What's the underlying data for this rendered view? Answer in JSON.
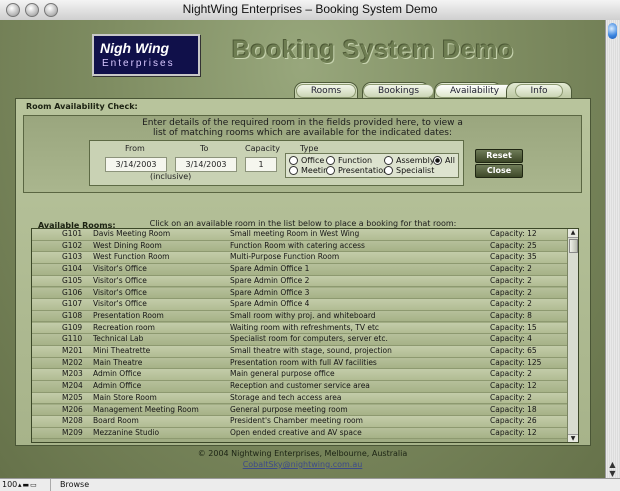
{
  "window": {
    "title": "NightWing Enterprises – Booking System Demo"
  },
  "logo": {
    "line1_a": "Nigh",
    "line1_b": "Wing",
    "line2": "Enterprises"
  },
  "header": {
    "title": "Booking System Demo"
  },
  "tabs": [
    {
      "label": "Rooms"
    },
    {
      "label": "Bookings"
    },
    {
      "label": "Availability"
    },
    {
      "label": "Info"
    }
  ],
  "check": {
    "label": "Room Availability Check:",
    "instruction1": "Enter details of the required room in the fields provided here, to view a",
    "instruction2": "list of matching rooms which are available for the indicated dates:",
    "from_label": "From",
    "to_label": "To",
    "capacity_label": "Capacity",
    "type_label": "Type",
    "from_value": "3/14/2003",
    "to_value": "3/14/2003",
    "capacity_value": "1",
    "inclusive": "(inclusive)",
    "types": [
      "Office",
      "Function",
      "Assembly",
      "All",
      "Meeting",
      "Presentation",
      "Specialist"
    ],
    "selected_type": "All",
    "reset": "Reset",
    "close": "Close"
  },
  "available": {
    "label": "Available Rooms:",
    "instruction": "Click on an available room in the list below to place a booking for that room:",
    "rows": [
      [
        "G101",
        "Davis Meeting Room",
        "Small meeting Room in West Wing",
        "Capacity: 12"
      ],
      [
        "G102",
        "West Dining Room",
        "Function Room with catering access",
        "Capacity: 25"
      ],
      [
        "G103",
        "West Function Room",
        "Multi-Purpose Function Room",
        "Capacity: 35"
      ],
      [
        "G104",
        "Visitor's Office",
        "Spare Admin Office 1",
        "Capacity: 2"
      ],
      [
        "G105",
        "Visitor's Office",
        "Spare Admin Office 2",
        "Capacity: 2"
      ],
      [
        "G106",
        "Visitor's Office",
        "Spare Admin Office 3",
        "Capacity: 2"
      ],
      [
        "G107",
        "Visitor's Office",
        "Spare Admin Office 4",
        "Capacity: 2"
      ],
      [
        "G108",
        "Presentation Room",
        "Small room withy proj. and whiteboard",
        "Capacity: 8"
      ],
      [
        "G109",
        "Recreation room",
        "Waiting room with refreshments, TV etc",
        "Capacity: 15"
      ],
      [
        "G110",
        "Technical Lab",
        "Specialist room for computers, server etc.",
        "Capacity: 4"
      ],
      [
        "M201",
        "Mini Theatrette",
        "Small theatre with stage, sound, projection",
        "Capacity: 65"
      ],
      [
        "M202",
        "Main Theatre",
        "Presentation room with full AV facilities",
        "Capacity: 125"
      ],
      [
        "M203",
        "Admin Office",
        "Main general purpose office",
        "Capacity: 2"
      ],
      [
        "M204",
        "Admin Office",
        "Reception and customer service area",
        "Capacity: 12"
      ],
      [
        "M205",
        "Main Store Room",
        "Storage and tech access area",
        "Capacity: 2"
      ],
      [
        "M206",
        "Management Meeting Room",
        "General purpose meeting room",
        "Capacity: 18"
      ],
      [
        "M208",
        "Board Room",
        "President's Chamber meeting room",
        "Capacity: 26"
      ],
      [
        "M209",
        "Mezzanine Studio",
        "Open ended creative and AV space",
        "Capacity: 12"
      ]
    ]
  },
  "footer": {
    "copyright": "© 2004 Nightwing Enterprises, Melbourne, Australia",
    "email": "CobaltSky@nightwing.com.au"
  },
  "statusbar": {
    "zoom": "100",
    "mode": "Browse"
  },
  "colors": {
    "background": "#7f8d62",
    "panel": "#b8c49c",
    "tab_border": "#4d5a38"
  }
}
